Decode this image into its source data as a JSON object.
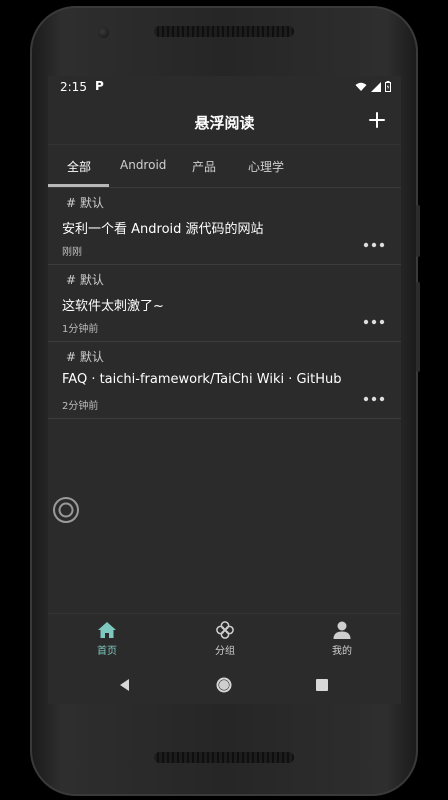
{
  "status": {
    "time": "2:15",
    "app_badge": "P"
  },
  "header": {
    "title": "悬浮阅读"
  },
  "tabs": [
    {
      "label": "全部"
    },
    {
      "label": "Android"
    },
    {
      "label": "产品"
    },
    {
      "label": "心理学"
    }
  ],
  "items": [
    {
      "tag": "# 默认",
      "title": "安利一个看 Android 源代码的网站",
      "time": "刚刚"
    },
    {
      "tag": "# 默认",
      "title": "这软件太刺激了~",
      "time": "1分钟前"
    },
    {
      "tag": "# 默认",
      "title": "FAQ · taichi-framework/TaiChi Wiki · GitHub",
      "time": "2分钟前"
    }
  ],
  "bottom_nav": [
    {
      "label": "首页",
      "icon": "home-icon"
    },
    {
      "label": "分组",
      "icon": "group-icon"
    },
    {
      "label": "我的",
      "icon": "person-icon"
    }
  ],
  "colors": {
    "accent": "#7ec8c0",
    "background": "#2b2b2b"
  }
}
